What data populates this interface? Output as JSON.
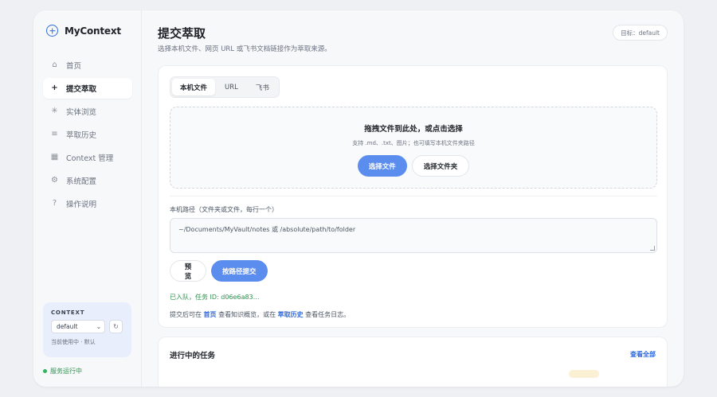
{
  "brand": {
    "name": "MyContext",
    "icon": "plus-circle-icon",
    "accent": "#2f6bde"
  },
  "sidebar": {
    "items": [
      {
        "label": "首页",
        "icon": "home-icon",
        "glyph": "⌂"
      },
      {
        "label": "提交萃取",
        "icon": "plus-icon",
        "glyph": "+"
      },
      {
        "label": "实体浏览",
        "icon": "sparkle-icon",
        "glyph": "✳"
      },
      {
        "label": "萃取历史",
        "icon": "list-icon",
        "glyph": "≡"
      },
      {
        "label": "Context 管理",
        "icon": "grid-icon",
        "glyph": "▦"
      },
      {
        "label": "系统配置",
        "icon": "gear-icon",
        "glyph": "⚙"
      },
      {
        "label": "操作说明",
        "icon": "help-circle-icon",
        "glyph": "?"
      }
    ],
    "active_index": 1
  },
  "context": {
    "label": "CONTEXT",
    "selected": "default",
    "chevron": "⌄",
    "refresh_glyph": "↻",
    "status": "当前使用中 · 默认"
  },
  "service": {
    "status": "服务运行中",
    "color": "#2fb35f"
  },
  "header": {
    "title": "提交萃取",
    "subtitle": "选择本机文件、网页 URL 或飞书文档链接作为萃取来源。",
    "target": "目标：default"
  },
  "submit": {
    "tabs": [
      {
        "label": "本机文件",
        "active": true
      },
      {
        "label": "URL",
        "active": false
      },
      {
        "label": "飞书",
        "active": false
      }
    ],
    "drop_title": "拖拽文件到此处，或点击选择",
    "drop_hint": "支持 .md、.txt、图片；也可填写本机文件夹路径",
    "choose_file": "选择文件",
    "choose_folder": "选择文件夹",
    "path_label": "本机路径（文件夹或文件，每行一个）",
    "path_placeholder": "~/Documents/MyVault/notes 或 /absolute/path/to/folder",
    "preview": "预览",
    "submit_path": "按路径提交",
    "queued": "已入队，任务 ID: d06e6a83…",
    "help_pre": "提交后可在 ",
    "help_link1": "首页",
    "help_mid": " 查看知识概览，或在 ",
    "help_link2": "萃取历史",
    "help_post": " 查看任务日志。"
  },
  "tasks": {
    "title": "进行中的任务",
    "view_all": "查看全部"
  },
  "colors": {
    "primary_button": "#5b8def",
    "success_text": "#2f8f4e",
    "link": "#2f6bde"
  }
}
